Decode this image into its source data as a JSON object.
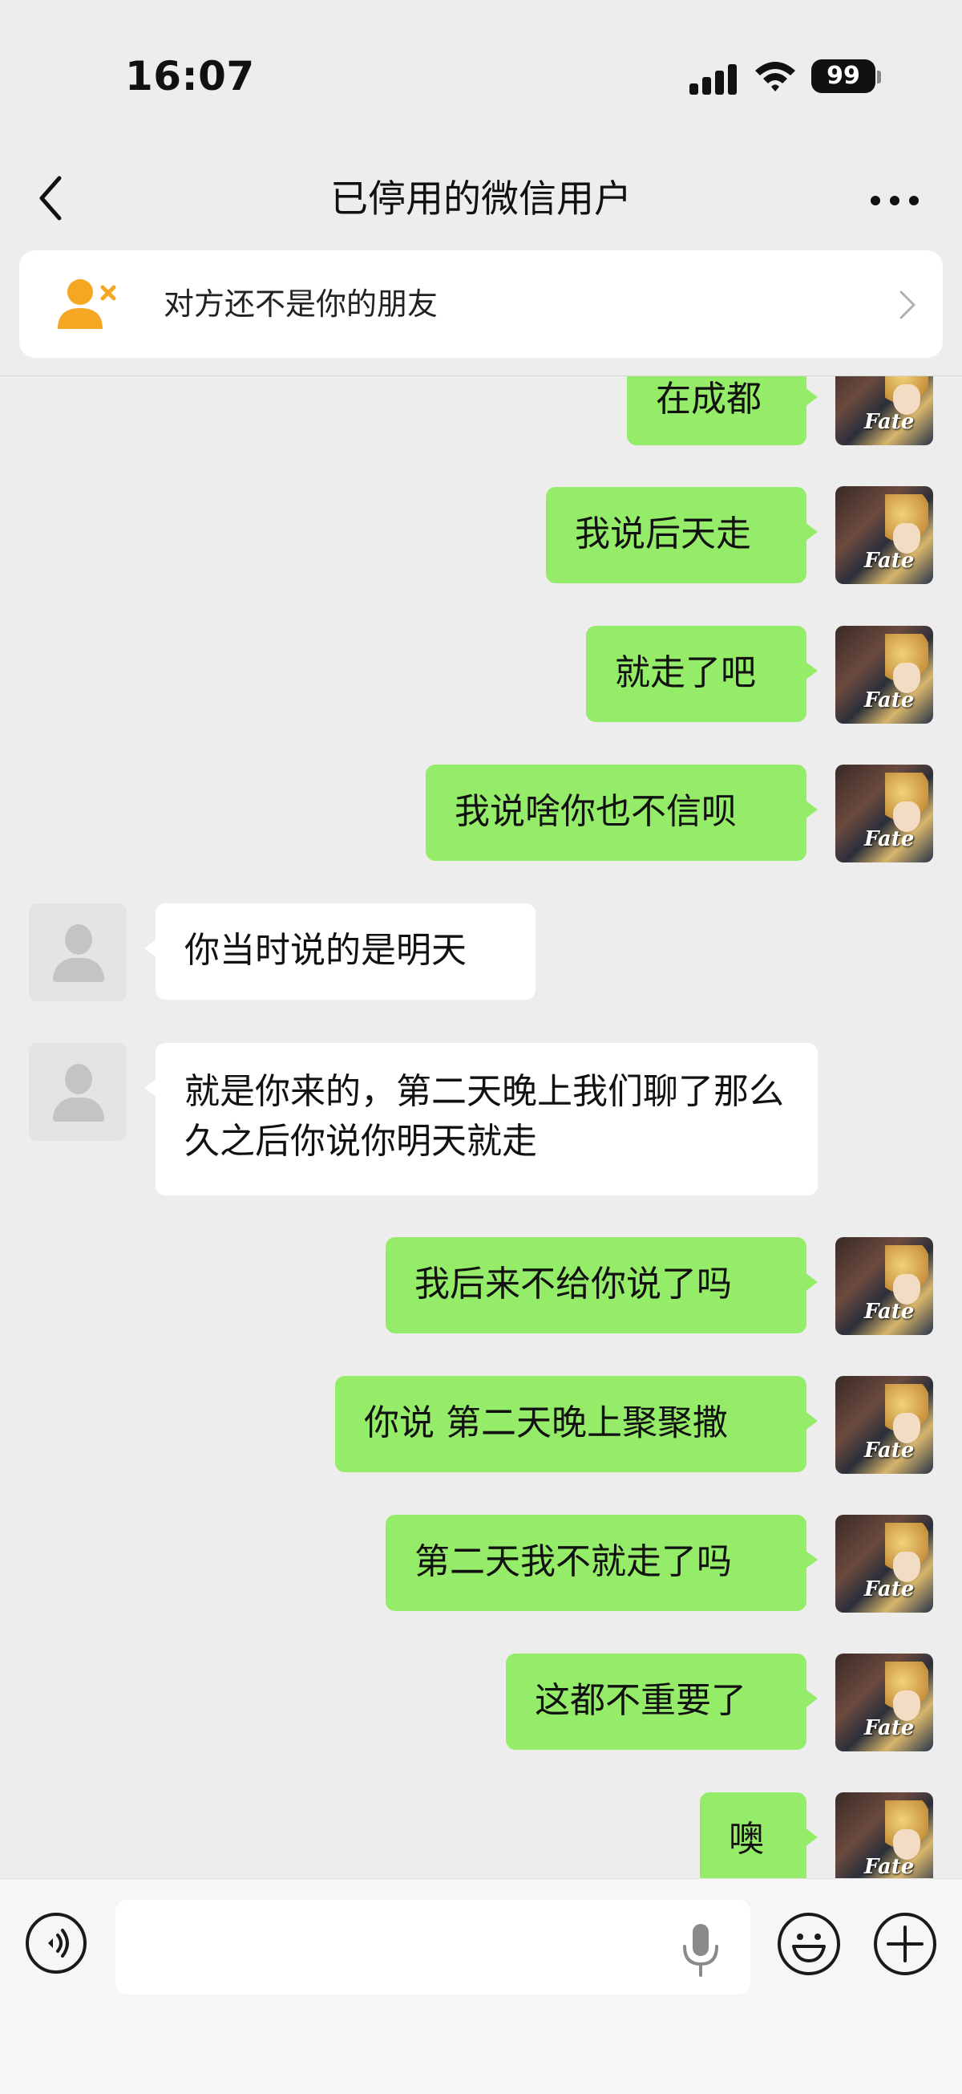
{
  "status_bar": {
    "time": "16:07",
    "battery": "99"
  },
  "nav": {
    "title": "已停用的微信用户"
  },
  "friend_notice": {
    "text": "对方还不是你的朋友"
  },
  "colors": {
    "sent_bubble": "#95ec69",
    "received_bubble": "#ffffff",
    "background": "#ededed",
    "notice_icon": "#f5a623"
  },
  "messages": [
    {
      "sender": "me",
      "text": "在成都"
    },
    {
      "sender": "me",
      "text": "我说后天走"
    },
    {
      "sender": "me",
      "text": "就走了吧"
    },
    {
      "sender": "me",
      "text": "我说啥你也不信呗"
    },
    {
      "sender": "other",
      "text": "你当时说的是明天"
    },
    {
      "sender": "other",
      "text": "就是你来的，第二天晚上我们聊了那么久之后你说你明天就走"
    },
    {
      "sender": "me",
      "text": "我后来不给你说了吗"
    },
    {
      "sender": "me",
      "text": "你说 第二天晚上聚聚撒"
    },
    {
      "sender": "me",
      "text": "第二天我不就走了吗"
    },
    {
      "sender": "me",
      "text": "这都不重要了"
    },
    {
      "sender": "me",
      "text": "噢"
    }
  ],
  "avatar_self": {
    "logo_text": "Fate"
  },
  "icons": {
    "back": "chevron-left-icon",
    "more": "more-dots-icon",
    "notice": "person-remove-icon",
    "voice": "voice-icon",
    "mic": "microphone-icon",
    "emoji": "emoji-icon",
    "plus": "plus-icon"
  }
}
